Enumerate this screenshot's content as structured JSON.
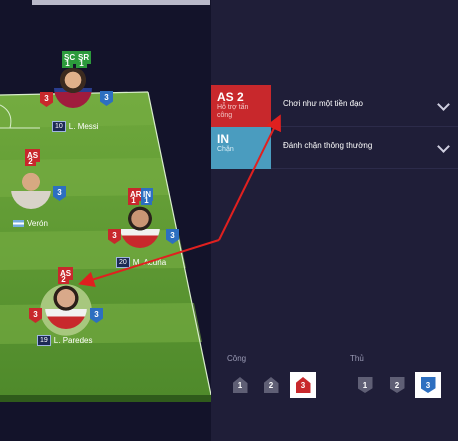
{
  "players": [
    {
      "id": "messi",
      "name": "L. Messi",
      "number": "10",
      "badges_top": [
        "SC",
        "SR"
      ],
      "badges_top_values": [
        "1",
        "1"
      ],
      "left_shield": "3",
      "right_shield": "3"
    },
    {
      "id": "veron",
      "name": "Verón",
      "badges_top": [
        "AS"
      ],
      "badges_top_values": [
        "2"
      ],
      "right_shield": "3"
    },
    {
      "id": "acuna",
      "name": "M. Acuña",
      "number": "20",
      "badges_top": [
        "AR",
        "IN"
      ],
      "badges_top_values": [
        "1",
        "1"
      ],
      "left_shield": "3",
      "right_shield": "3"
    },
    {
      "id": "paredes",
      "name": "L. Paredes",
      "number": "19",
      "badges_top": [
        "AS"
      ],
      "badges_top_values": [
        "2"
      ],
      "left_shield": "3",
      "right_shield": "3"
    }
  ],
  "roles": [
    {
      "code": "AS 2",
      "sub": "Hỗ trợ tấn công",
      "text": "Chơi như một tiền đạo",
      "color": "#c8282c"
    },
    {
      "code": "IN",
      "sub": "Chặn",
      "text": "Đánh chặn thông thường",
      "color": "#4a9cbf"
    }
  ],
  "attack": {
    "label": "Công",
    "levels": [
      "1",
      "2",
      "3"
    ],
    "selected": "3"
  },
  "defense": {
    "label": "Thủ",
    "levels": [
      "1",
      "2",
      "3"
    ],
    "selected": "3"
  }
}
